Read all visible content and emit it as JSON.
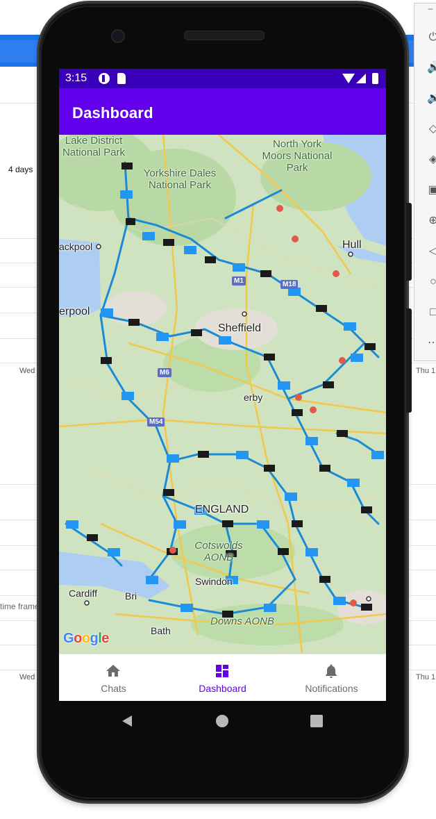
{
  "background": {
    "days_label": "4 days",
    "x_start_label": "Wed",
    "x_end_label": "Thu 1",
    "time_frame_text": "time frame"
  },
  "phone": {
    "status_bar": {
      "time": "3:15"
    },
    "app_bar": {
      "title": "Dashboard"
    },
    "map": {
      "labels": {
        "lake_district": "Lake District National Park",
        "north_york_moors": "North York Moors National Park",
        "yorkshire_dales": "Yorkshire Dales National Park",
        "blackpool": "ackpool",
        "liverpool": "erpool",
        "hull": "Hull",
        "sheffield": "Sheffield",
        "england": "ENGLAND",
        "cotswolds": "Cotswolds AONB",
        "cardiff": "Cardiff",
        "bristol": "Bri",
        "swindon": "Swindon",
        "bath": "Bath",
        "downs": "Downs AONB",
        "derby": "erby",
        "road_m1": "M1",
        "road_m18": "M18",
        "road_m6": "M6",
        "road_m54": "M54"
      },
      "attribution": "Google"
    },
    "bottom_nav": {
      "items": [
        {
          "label": "Chats",
          "icon": "home-icon",
          "active": false
        },
        {
          "label": "Dashboard",
          "icon": "dashboard-icon",
          "active": true
        },
        {
          "label": "Notifications",
          "icon": "bell-icon",
          "active": false
        }
      ]
    },
    "colors": {
      "status_bar": "#3a00b9",
      "app_bar": "#6200ee",
      "accent": "#6200ee"
    }
  }
}
